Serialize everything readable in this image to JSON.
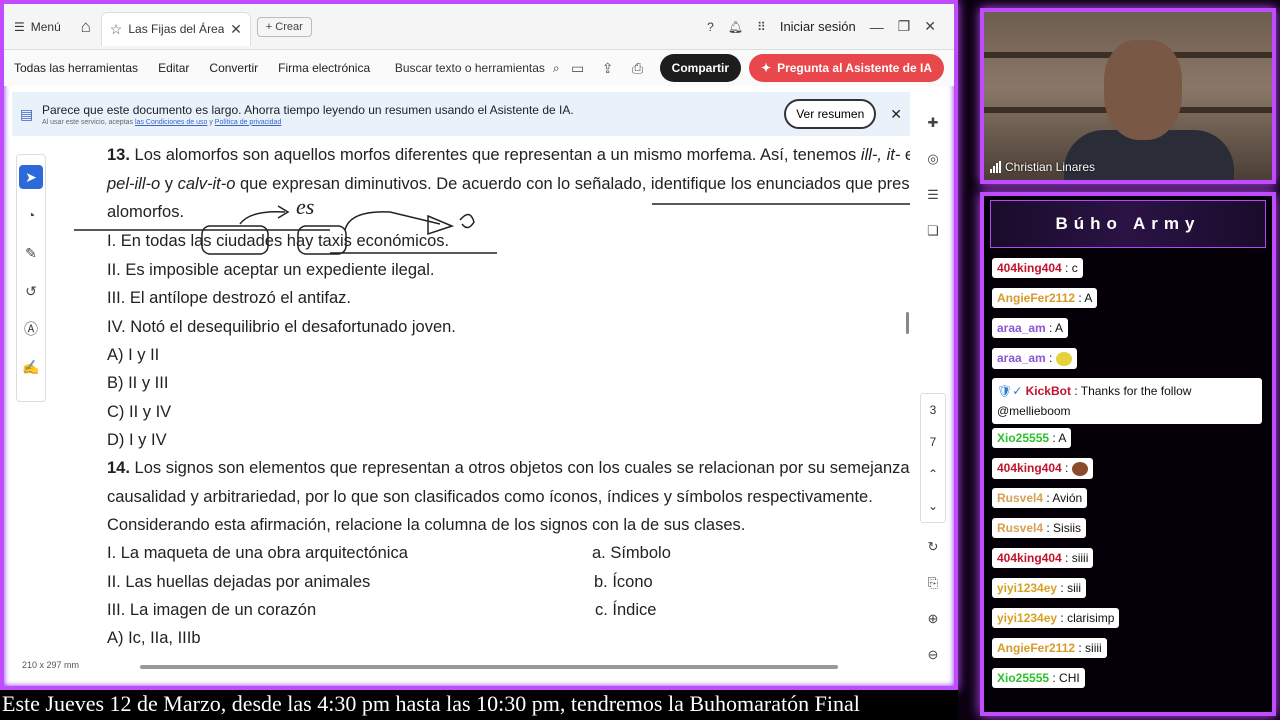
{
  "browser": {
    "menu_label": "Menú",
    "tab_title": "Las Fijas del Área A ...",
    "new_tab_label": "Crear",
    "login_label": "Iniciar sesión"
  },
  "toolbar": {
    "all_tools": "Todas las herramientas",
    "edit": "Editar",
    "convert": "Convertir",
    "esign": "Firma electrónica",
    "search_placeholder": "Buscar texto o herramientas",
    "share": "Compartir",
    "ai_assistant": "Pregunta al Asistente de IA"
  },
  "banner": {
    "message": "Parece que este documento es largo. Ahorra tiempo leyendo un resumen usando el Asistente de IA.",
    "fine_print_prefix": "Al usar este servicio, aceptas",
    "terms_link": "las Condiciones de uso",
    "and": "y",
    "privacy_link": "Política de privacidad",
    "view_summary": "Ver resumen"
  },
  "page_nav": {
    "current": "3",
    "total": "7"
  },
  "page_size": "210 x 297 mm",
  "document": {
    "q13": {
      "num": "13.",
      "text_a": "Los alomorfos son aquellos morfos diferentes que representan a un mismo morfema. Así, tenemos ",
      "italic_a": "ill-, it-",
      "text_b": " en",
      "italic_b": "pel-ill-o",
      "text_c": " y ",
      "italic_c": "calv-it-o",
      "text_d": " que expresan diminutivos. De acuerdo con lo señalado, identifique los enunciados que presentan",
      "text_e": "alomorfos.",
      "items": [
        "I. En todas las ciudades hay taxis económicos.",
        "II. Es imposible aceptar un expediente ilegal.",
        "III. El antílope destrozó el antifaz.",
        "IV. Notó el desequilibrio el desafortunado joven."
      ],
      "options": [
        "A) I y II",
        "B) II y III",
        "C) II y IV",
        "D) I y IV"
      ],
      "annotation": "es"
    },
    "q14": {
      "num": "14.",
      "line1": "Los signos son elementos que representan a otros objetos con los cuales se relacionan por su semejanza,",
      "line2": "causalidad y arbitrariedad, por lo que son clasificados como íconos, índices y símbolos respectivamente.",
      "line3": "Considerando esta afirmación, relacione la columna de los signos con la de sus clases.",
      "left": [
        "I. La maqueta de una obra arquitectónica",
        "II. Las huellas dejadas por animales",
        "III. La imagen de un corazón"
      ],
      "right": [
        "a. Símbolo",
        "b. Ícono",
        "c. Índice"
      ],
      "option_a": "A) Ic, IIa, IIIb"
    }
  },
  "ticker": "Este Jueves 12 de Marzo, desde las 4:30 pm hasta las 10:30 pm, tendremos la Buhomaratón Final",
  "webcam": {
    "name": "Christian Linares"
  },
  "chat": {
    "title": "Búho Army",
    "messages": [
      {
        "user": "404king404",
        "color": "#c0142c",
        "text": ": c"
      },
      {
        "user": "AngieFer2112",
        "color": "#d89a2a",
        "text": ": A"
      },
      {
        "user": "araa_am",
        "color": "#8a58d0",
        "text": ": A"
      },
      {
        "user": "araa_am",
        "color": "#8a58d0",
        "text": ":"
      },
      {
        "user": "KickBot",
        "color": "#c0142c",
        "text": ": Thanks for the follow @mellieboom"
      },
      {
        "user": "Xio25555",
        "color": "#2fbf2f",
        "text": ": A"
      },
      {
        "user": "404king404",
        "color": "#c0142c",
        "text": ":"
      },
      {
        "user": "Rusvel4",
        "color": "#d8a050",
        "text": ": Avión"
      },
      {
        "user": "Rusvel4",
        "color": "#d8a050",
        "text": ": Sisiis"
      },
      {
        "user": "404king404",
        "color": "#c0142c",
        "text": ": siiii"
      },
      {
        "user": "yiyi1234ey",
        "color": "#d8a020",
        "text": ": siii"
      },
      {
        "user": "yiyi1234ey",
        "color": "#d8a020",
        "text": ": clarisimp"
      },
      {
        "user": "AngieFer2112",
        "color": "#d89a2a",
        "text": ": siiii"
      },
      {
        "user": "Xio25555",
        "color": "#2fbf2f",
        "text": ": CHI"
      }
    ]
  }
}
